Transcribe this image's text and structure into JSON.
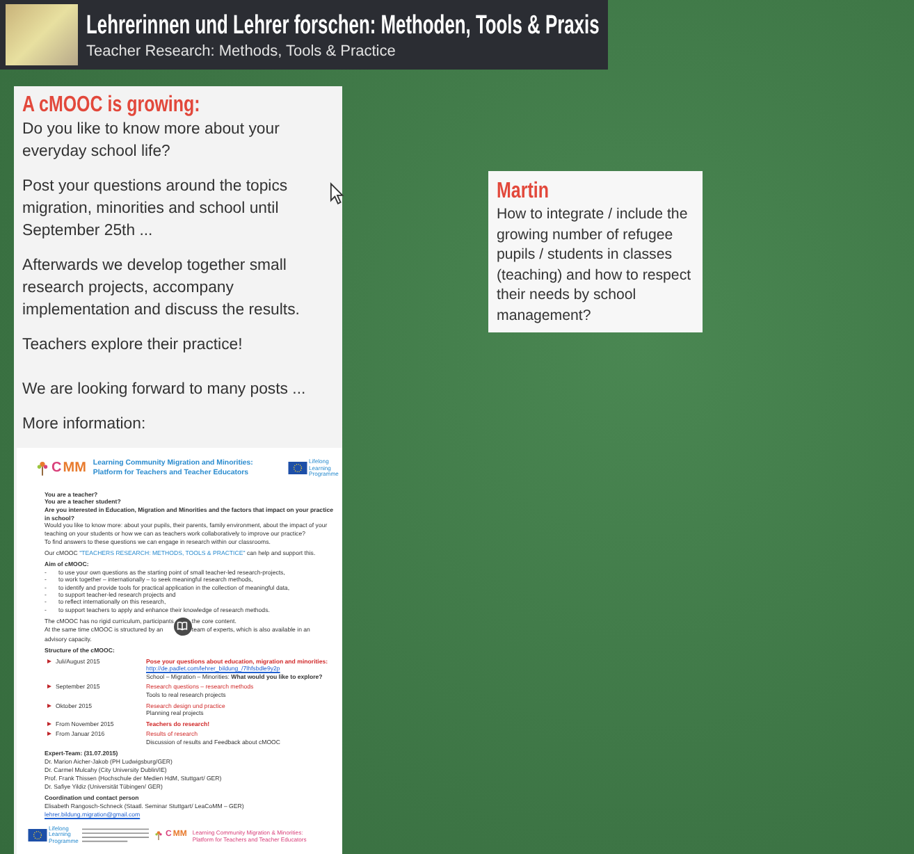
{
  "header": {
    "title": "Lehrerinnen und Lehrer forschen: Methoden, Tools & Praxis",
    "subtitle": "Teacher Research: Methods, Tools & Practice"
  },
  "posts": [
    {
      "kind": "info",
      "title": "A cMOOC is growing:",
      "paragraphs": [
        "Do you like to know more about your everyday school life?",
        "Post your questions around the topics migration, minorities and school until September 25th ...",
        "Afterwards we develop together small research projects, accompany implementation and discuss the results.",
        "Teachers explore their practice!",
        "We are looking forward to many posts ...",
        "More information:"
      ],
      "document": {
        "logo_a": "C",
        "logo_b": "MM",
        "org_title": [
          "Learning Community Migration and Minorities:",
          "Platform for Teachers and Teacher Educators"
        ],
        "eu_label": "Lifelong Learning Programme",
        "questions": [
          "You are a teacher?",
          "You are a teacher student?",
          "Are you interested in Education, Migration and Minorities and the factors that impact on your practice in school?"
        ],
        "intro": [
          "Would you like to know more: about your pupils, their parents, family environment, about the impact of your teaching on your students or how we can as teachers work collaboratively to improve our practice?",
          "To find answers to these questions we can engage in research within our classrooms."
        ],
        "cmooc": {
          "before": "Our cMOOC ",
          "highlight": "\"TEACHERS RESEARCH: METHODS, TOOLS & PRACTICE\"",
          "after": " can help and support this."
        },
        "aim_heading": "Aim of cMOOC:",
        "aims": [
          {
            "marker": "-",
            "text": "to use your own questions as the starting point of small teacher-led research-projects,"
          },
          {
            "marker": "-",
            "text": "to work together – internationally – to seek meaningful research methods,"
          },
          {
            "marker": "-",
            "text": "to identify and provide tools for practical application in the collection of meaningful data,"
          },
          {
            "marker": "-",
            "text": "to support teacher-led research projects and"
          },
          {
            "marker": "-",
            "text": "to reflect internationally on this research,"
          },
          {
            "marker": "-",
            "text": "to support teachers to apply and enhance their knowledge of research methods."
          }
        ],
        "curriculum": [
          {
            "start": "The cMOOC has no rigid curriculum, participants",
            "end": "the core content."
          },
          {
            "start": "At the same time cMOOC is structured by an",
            "end": "team of experts, which is also available in an"
          },
          {
            "start": "advisory capacity."
          }
        ],
        "structure_heading": "Structure of the cMOOC:",
        "schedule": [
          {
            "date": "Juli/August 2015",
            "heading": "Pose your questions about education, migration and minorities:",
            "bold": true,
            "lines": [
              {
                "kind": "link",
                "text": "http://de.padlet.com/lehrer_bildung_/7lhfsbdle9y2p"
              },
              {
                "kind": "text",
                "text": "School – Migration – Minorities: **What would you like to explore?**"
              }
            ]
          },
          {
            "date": "September 2015",
            "heading": "Research questions – research methods",
            "bold": false,
            "lines": [
              {
                "kind": "text",
                "text": "Tools to real research projects"
              }
            ]
          },
          {
            "date": "Oktober 2015",
            "heading": "Research design und practice",
            "bold": false,
            "lines": [
              {
                "kind": "text",
                "text": "Planning real projects"
              }
            ]
          },
          {
            "date": "From November 2015",
            "heading": "Teachers do research!",
            "bold": true
          },
          {
            "date": "From Januar 2016",
            "heading": "Results of research",
            "bold": false,
            "lines": [
              {
                "kind": "text",
                "text": "Discussion of results and Feedback about cMOOC"
              }
            ]
          }
        ],
        "expert_heading": "Expert-Team: (31.07.2015)",
        "experts": [
          "Dr. Marion Aicher-Jakob (PH Ludwigsburg/GER)",
          "Dr. Carmel Mulcahy (City University Dublin/IE)",
          "Prof. Frank Thissen (Hochschule der Medien HdM, Stuttgart/ GER)",
          "Dr. Safiye Yildiz (Universität Tübingen/ GER)"
        ],
        "contact_heading": "Coordination und contact person",
        "contact": "Elisabeth Rangosch-Schneck (Staatl. Seminar Stuttgart/ LeaCoMM – GER)",
        "email": "lehrer.bildung.migration@gmail.com",
        "footer_eu_label": "Lifelong Learning Programme",
        "footer_logo_a": "C",
        "footer_logo_b": "MM",
        "footer_title": [
          "Learning Community Migration & Minorities:",
          "Platform for Teachers and Teacher Educators"
        ]
      }
    },
    {
      "kind": "note",
      "title": "Martin",
      "body": "How to integrate / include the growing number of refugee pupils / students in classes (teaching) and how to respect their needs by school management?"
    }
  ]
}
